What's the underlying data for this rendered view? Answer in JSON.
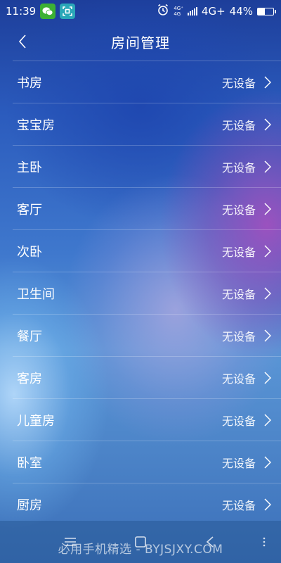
{
  "status_bar": {
    "time": "11:39",
    "network_top": "4G⁺",
    "network_bottom": "4G",
    "network_type": "4G+",
    "battery": "44%",
    "battery_level": 0.44,
    "icons": [
      "wechat-icon",
      "screenshot-icon",
      "alarm-icon",
      "signal-icon",
      "battery-icon"
    ]
  },
  "header": {
    "title": "房间管理",
    "back_icon": "chevron-left-icon"
  },
  "rooms": [
    {
      "name": "书房",
      "status": "无设备"
    },
    {
      "name": "宝宝房",
      "status": "无设备"
    },
    {
      "name": "主卧",
      "status": "无设备"
    },
    {
      "name": "客厅",
      "status": "无设备"
    },
    {
      "name": "次卧",
      "status": "无设备"
    },
    {
      "name": "卫生间",
      "status": "无设备"
    },
    {
      "name": "餐厅",
      "status": "无设备"
    },
    {
      "name": "客房",
      "status": "无设备"
    },
    {
      "name": "儿童房",
      "status": "无设备"
    },
    {
      "name": "卧室",
      "status": "无设备"
    },
    {
      "name": "厨房",
      "status": "无设备"
    }
  ],
  "nav_bar": {
    "watermark": "必用手机精选 - BYJSJXY.COM",
    "icons": [
      "menu-icon",
      "home-icon",
      "back-icon",
      "more-icon"
    ]
  },
  "colors": {
    "bg_top": "#1d3e9a",
    "bg_mid": "#5a96d6",
    "accent_purple": "#a050be",
    "text": "#ffffff"
  }
}
